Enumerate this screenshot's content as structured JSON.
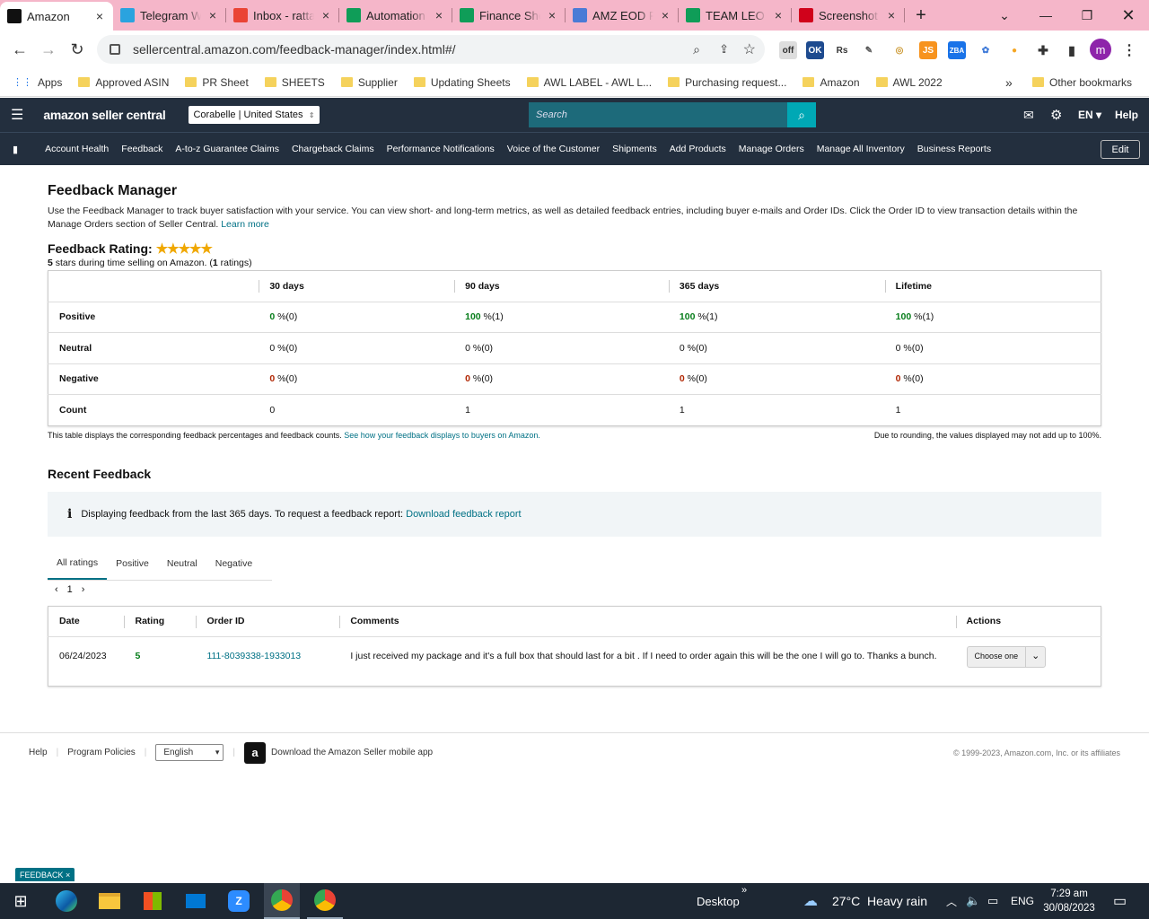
{
  "browser": {
    "tabs": [
      {
        "label": "Amazon",
        "icon": "amazon-a-icon",
        "color": "#111111",
        "active": true
      },
      {
        "label": "Telegram Web",
        "icon": "telegram-icon",
        "color": "#2aa3df"
      },
      {
        "label": "Inbox - rattan",
        "icon": "gmail-icon",
        "color": "#ea4335"
      },
      {
        "label": "Automation",
        "icon": "sheets-icon",
        "color": "#0f9d58"
      },
      {
        "label": "Finance Sheet",
        "icon": "sheets-icon",
        "color": "#0f9d58"
      },
      {
        "label": "AMZ EOD Report",
        "icon": "pen-icon",
        "color": "#4a7bd6"
      },
      {
        "label": "TEAM LEO",
        "icon": "sheets-icon",
        "color": "#0f9d58"
      },
      {
        "label": "Screenshot",
        "icon": "screenshot-icon",
        "color": "#d0021b"
      }
    ],
    "url": "sellercentral.amazon.com/feedback-manager/index.html#/",
    "profile_initial": "m",
    "bookmarks": [
      "Apps",
      "Approved ASIN",
      "PR Sheet",
      "SHEETS",
      "Supplier",
      "Updating Sheets",
      "AWL LABEL - AWL L...",
      "Purchasing request...",
      "Amazon",
      "AWL 2022"
    ],
    "overflow": "»",
    "other_bookmarks": "Other bookmarks"
  },
  "header": {
    "logo": "amazon seller central",
    "account": "Corabelle | United States",
    "search_placeholder": "Search",
    "lang": "EN",
    "help": "Help"
  },
  "nav": {
    "items": [
      "Account Health",
      "Feedback",
      "A-to-z Guarantee Claims",
      "Chargeback Claims",
      "Performance Notifications",
      "Voice of the Customer",
      "Shipments",
      "Add Products",
      "Manage Orders",
      "Manage All Inventory",
      "Business Reports"
    ],
    "edit": "Edit"
  },
  "page": {
    "title": "Feedback Manager",
    "description": "Use the Feedback Manager to track buyer satisfaction with your service. You can view short- and long-term metrics, as well as detailed feedback entries, including buyer e-mails and Order IDs. Click the Order ID to view transaction details within the Manage Orders section of Seller Central.",
    "learn_more": "Learn more",
    "rating_label": "Feedback Rating:",
    "stars": "★★★★★",
    "rating_sub_a": "5",
    "rating_sub_b": " stars during time selling on Amazon. (",
    "rating_sub_c": "1",
    "rating_sub_d": " ratings)"
  },
  "summary": {
    "headers": [
      "30 days",
      "90 days",
      "365 days",
      "Lifetime"
    ],
    "rows": [
      {
        "label": "Positive",
        "cells": [
          [
            "0",
            " %(0)"
          ],
          [
            "100",
            " %(1)"
          ],
          [
            "100",
            " %(1)"
          ],
          [
            "100",
            " %(1)"
          ]
        ]
      },
      {
        "label": "Neutral",
        "cells": [
          [
            "0 %(0)",
            ""
          ],
          [
            "0 %(0)",
            ""
          ],
          [
            "0 %(0)",
            ""
          ],
          [
            "0 %(0)",
            ""
          ]
        ]
      },
      {
        "label": "Negative",
        "cells": [
          [
            "0",
            " %(0)"
          ],
          [
            "0",
            " %(0)"
          ],
          [
            "0",
            " %(0)"
          ],
          [
            "0",
            " %(0)"
          ]
        ]
      },
      {
        "label": "Count",
        "cells": [
          [
            "0",
            ""
          ],
          [
            "1",
            ""
          ],
          [
            "1",
            ""
          ],
          [
            "1",
            ""
          ]
        ]
      }
    ],
    "note": "This table displays the corresponding feedback percentages and feedback counts.",
    "note_link": "See how your feedback displays to buyers on Amazon.",
    "rounding": "Due to rounding, the values displayed may not add up to 100%."
  },
  "recent": {
    "title": "Recent Feedback",
    "info": "Displaying feedback from the last 365 days. To request a feedback report:",
    "info_link": "Download feedback report",
    "tabs": [
      "All ratings",
      "Positive",
      "Neutral",
      "Negative"
    ],
    "page": "1",
    "columns": [
      "Date",
      "Rating",
      "Order ID",
      "Comments",
      "Actions"
    ],
    "rows": [
      {
        "date": "06/24/2023",
        "rating": "5",
        "order_id": "111-8039338-1933013",
        "comment": "I just received my package and it's a full box that should last for a bit . If I need to order again this will be the one I will go to. Thanks a bunch.",
        "action": "Choose one"
      }
    ]
  },
  "footer": {
    "help": "Help",
    "policies": "Program Policies",
    "language": "English",
    "app": "Download the Amazon Seller mobile app",
    "copyright": "© 1999-2023, Amazon.com, Inc. or its affiliates",
    "feedback_tab": "FEEDBACK ×"
  },
  "taskbar": {
    "desktop": "Desktop",
    "weather": "27°C  Heavy rain",
    "lang": "ENG",
    "time": "7:29 am",
    "date": "30/08/2023"
  },
  "colors": {
    "header_bg": "#232f3e",
    "accent": "#007185",
    "search_btn": "#00a8b5",
    "tabbar": "#f5b6c9"
  }
}
